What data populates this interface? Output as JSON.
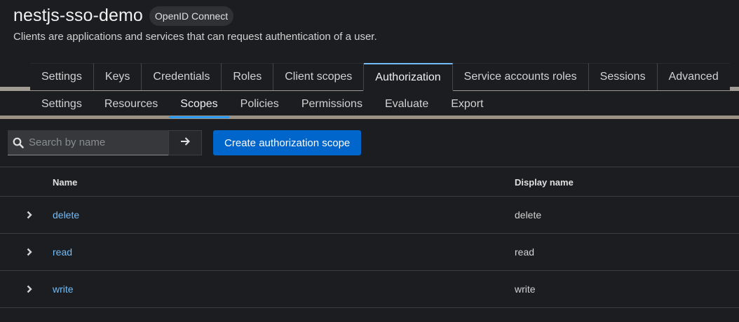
{
  "header": {
    "title": "nestjs-sso-demo",
    "badge": "OpenID Connect",
    "subtitle": "Clients are applications and services that can request authentication of a user."
  },
  "tabs": [
    {
      "label": "Settings"
    },
    {
      "label": "Keys"
    },
    {
      "label": "Credentials"
    },
    {
      "label": "Roles"
    },
    {
      "label": "Client scopes"
    },
    {
      "label": "Authorization",
      "active": true
    },
    {
      "label": "Service accounts roles"
    },
    {
      "label": "Sessions"
    },
    {
      "label": "Advanced"
    }
  ],
  "subtabs": [
    {
      "label": "Settings"
    },
    {
      "label": "Resources"
    },
    {
      "label": "Scopes",
      "active": true
    },
    {
      "label": "Policies"
    },
    {
      "label": "Permissions"
    },
    {
      "label": "Evaluate"
    },
    {
      "label": "Export"
    }
  ],
  "toolbar": {
    "search_placeholder": "Search by name",
    "search_icon": "search-icon",
    "go_icon": "arrow-right-icon",
    "create_label": "Create authorization scope"
  },
  "table": {
    "columns": [
      "Name",
      "Display name"
    ],
    "rows": [
      {
        "name": "delete",
        "display_name": "delete"
      },
      {
        "name": "read",
        "display_name": "read"
      },
      {
        "name": "write",
        "display_name": "write"
      }
    ]
  },
  "colors": {
    "background": "#1b1d21",
    "link": "#73bcf7",
    "primary_button": "#0066cc",
    "active_tab_indicator": "#2b9af3"
  }
}
